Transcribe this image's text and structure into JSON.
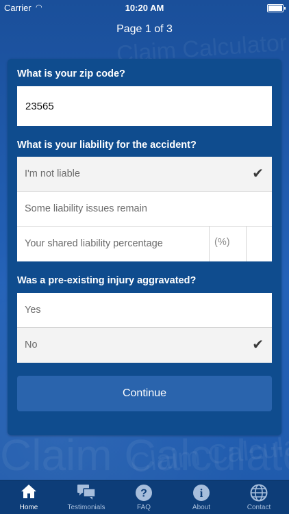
{
  "status_bar": {
    "carrier": "Carrier",
    "time": "10:20 AM"
  },
  "nav": {
    "title": "Page 1 of 3"
  },
  "background": {
    "watermark": "Claim Calculator"
  },
  "form": {
    "zip": {
      "label": "What is your zip code?",
      "value": "23565"
    },
    "liability": {
      "label": "What is your liability for the accident?",
      "options": [
        {
          "label": "I'm not liable",
          "selected": true
        },
        {
          "label": "Some liability issues remain",
          "selected": false
        }
      ],
      "shared_label": "Your shared liability percentage",
      "shared_unit": "(%)"
    },
    "preexisting": {
      "label": "Was a pre-existing injury aggravated?",
      "options": [
        {
          "label": "Yes",
          "selected": false
        },
        {
          "label": "No",
          "selected": true
        }
      ]
    },
    "continue_label": "Continue"
  },
  "tabs": [
    {
      "label": "Home",
      "icon": "home-icon",
      "active": true
    },
    {
      "label": "Testimonials",
      "icon": "chat-bubbles-icon",
      "active": false
    },
    {
      "label": "FAQ",
      "icon": "question-icon",
      "active": false
    },
    {
      "label": "About",
      "icon": "info-icon",
      "active": false
    },
    {
      "label": "Contact",
      "icon": "globe-icon",
      "active": false
    }
  ],
  "colors": {
    "card": "#0f4c8e",
    "background": "#1d57a6",
    "tabbar": "#0d3d78",
    "button": "#2a64ad"
  }
}
